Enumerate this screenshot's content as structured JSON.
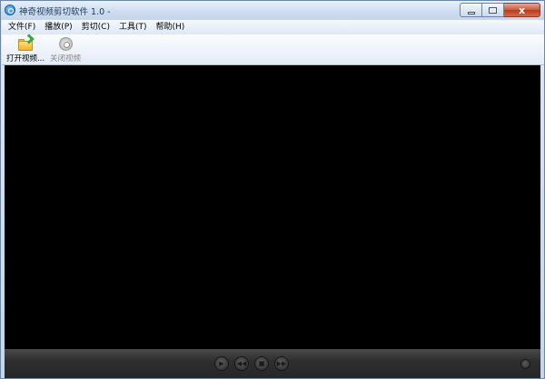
{
  "window": {
    "title": "神奇视频剪切软件 1.0 -",
    "app_icon": "app-logo-icon",
    "controls": {
      "minimize": "minimize-icon",
      "maximize": "maximize-icon",
      "close": "close-icon",
      "close_glyph": "x"
    }
  },
  "menu": {
    "items": [
      {
        "label": "文件(F)"
      },
      {
        "label": "播放(P)"
      },
      {
        "label": "剪切(C)"
      },
      {
        "label": "工具(T)"
      },
      {
        "label": "帮助(H)"
      }
    ]
  },
  "toolbar": {
    "open_video": {
      "label": "打开视频...",
      "icon": "open-folder-icon",
      "enabled": true
    },
    "close_video": {
      "label": "关闭视频",
      "icon": "disc-icon",
      "enabled": false
    }
  },
  "player": {
    "background": "#000000",
    "controls": [
      {
        "name": "play-icon"
      },
      {
        "name": "rewind-icon"
      },
      {
        "name": "stop-icon"
      },
      {
        "name": "forward-icon"
      }
    ],
    "volume_icon": "volume-icon"
  },
  "colors": {
    "title_text": "#1e395b",
    "close_button": "#c75a3e",
    "control_bar": "#2f2f2f",
    "disabled_text": "#8a8a8a"
  }
}
